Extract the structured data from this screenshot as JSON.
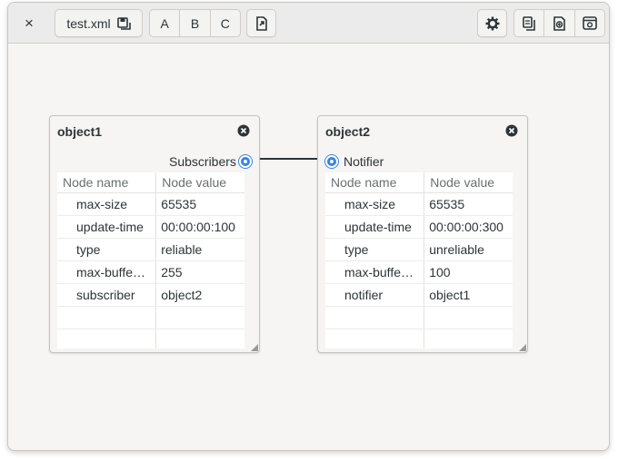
{
  "toolbar": {
    "close_glyph": "×",
    "file_name": "test.xml",
    "group_buttons": [
      "A",
      "B",
      "C"
    ],
    "icons": [
      "close-icon",
      "save-icon",
      "export-icon",
      "settings-icon",
      "copy-icon",
      "zoom-icon",
      "fit-view-icon"
    ]
  },
  "colors": {
    "accent": "#3584e4",
    "window_bg": "#f6f5f4",
    "headerbar_bg": "#ebebeb"
  },
  "nodes": [
    {
      "title": "object1",
      "port_label": "Subscribers",
      "header": {
        "name": "Node name",
        "value": "Node value"
      },
      "rows": [
        {
          "name": "max-size",
          "value": "65535"
        },
        {
          "name": "update-time",
          "value": "00:00:00:100"
        },
        {
          "name": "type",
          "value": "reliable"
        },
        {
          "name": "max-buffe…",
          "value": "255"
        },
        {
          "name": "subscriber",
          "value": "object2"
        }
      ]
    },
    {
      "title": "object2",
      "port_label": "Notifier",
      "header": {
        "name": "Node name",
        "value": "Node value"
      },
      "rows": [
        {
          "name": "max-size",
          "value": "65535"
        },
        {
          "name": "update-time",
          "value": "00:00:00:300"
        },
        {
          "name": "type",
          "value": "unreliable"
        },
        {
          "name": "max-buffe…",
          "value": "100"
        },
        {
          "name": "notifier",
          "value": "object1"
        }
      ]
    }
  ]
}
